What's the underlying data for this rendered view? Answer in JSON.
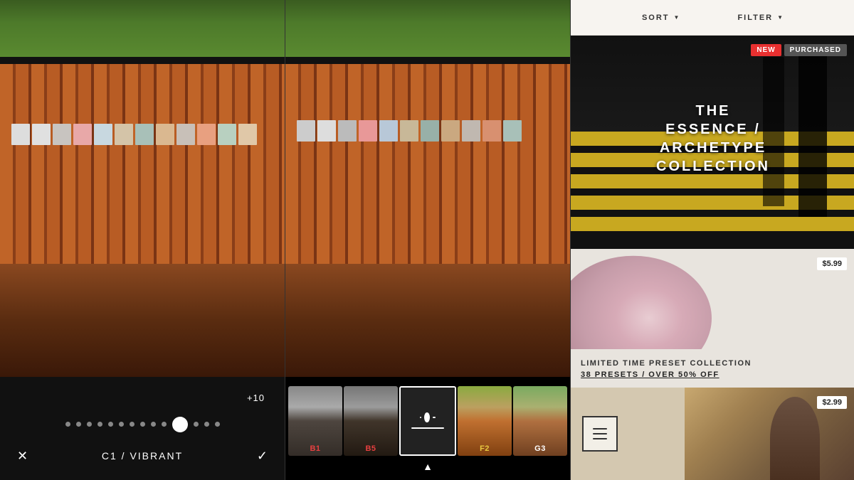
{
  "panels": {
    "editor": {
      "slider_value": "+10",
      "preset_name": "C1 / VIBRANT",
      "close_label": "✕",
      "check_label": "✓"
    },
    "presets": {
      "items": [
        {
          "id": "b1",
          "label": "B1",
          "label_color": "red",
          "active": false
        },
        {
          "id": "b5",
          "label": "B5",
          "label_color": "red",
          "active": false
        },
        {
          "id": "c1",
          "label": "",
          "label_color": "white",
          "active": true
        },
        {
          "id": "f2",
          "label": "F2",
          "label_color": "yellow",
          "active": false
        },
        {
          "id": "g3",
          "label": "G3",
          "label_color": "white",
          "active": false
        }
      ],
      "up_arrow": "▲"
    },
    "store": {
      "header": {
        "sort_label": "SORT",
        "filter_label": "FILTER",
        "sort_arrow": "▼",
        "filter_arrow": "▼"
      },
      "collection_main": {
        "badge_new": "NEW",
        "badge_purchased": "PURCHASED",
        "title_line1": "THE",
        "title_line2": "ESSENCE / ARCHETYPE",
        "title_line3": "COLLECTION"
      },
      "collection_secondary": {
        "price": "$5.99",
        "title_line1": "LIMITED TIME PRESET COLLECTION",
        "title_line2": "38 PRESETS / OVER 50% OFF"
      },
      "collection_bottom": {
        "price": "$2.99"
      }
    }
  }
}
